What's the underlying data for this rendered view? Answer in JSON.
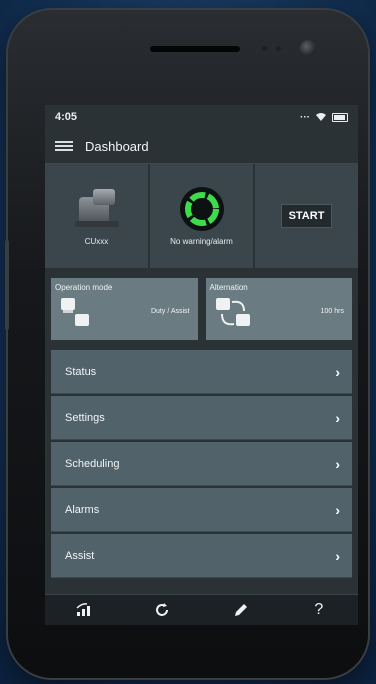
{
  "status_bar": {
    "time": "4:05"
  },
  "app_bar": {
    "title": "Dashboard",
    "menu_icon": "hamburger-icon"
  },
  "tiles": {
    "device": {
      "label": "CUxxx",
      "icon": "pump-icon"
    },
    "alarm": {
      "label": "No warning/alarm",
      "icon": "status-ring-icon",
      "color": "#3ddc4a"
    },
    "start": {
      "label": "START"
    }
  },
  "cards": {
    "operation_mode": {
      "title": "Operation mode",
      "value": "Duty / Assist",
      "icon": "pumps-icon"
    },
    "alternation": {
      "title": "Alternation",
      "value": "100 hrs",
      "icon": "alternation-icon"
    }
  },
  "menu_items": [
    {
      "label": "Status"
    },
    {
      "label": "Settings"
    },
    {
      "label": "Scheduling"
    },
    {
      "label": "Alarms"
    },
    {
      "label": "Assist"
    }
  ],
  "nav": {
    "items": [
      {
        "icon": "wireless-icon"
      },
      {
        "icon": "refresh-icon"
      },
      {
        "icon": "edit-icon"
      },
      {
        "icon": "help-icon",
        "glyph": "?"
      }
    ]
  },
  "colors": {
    "accent_green": "#3ddc4a",
    "row_bg": "#51626a",
    "card_bg": "#6b7b82"
  }
}
